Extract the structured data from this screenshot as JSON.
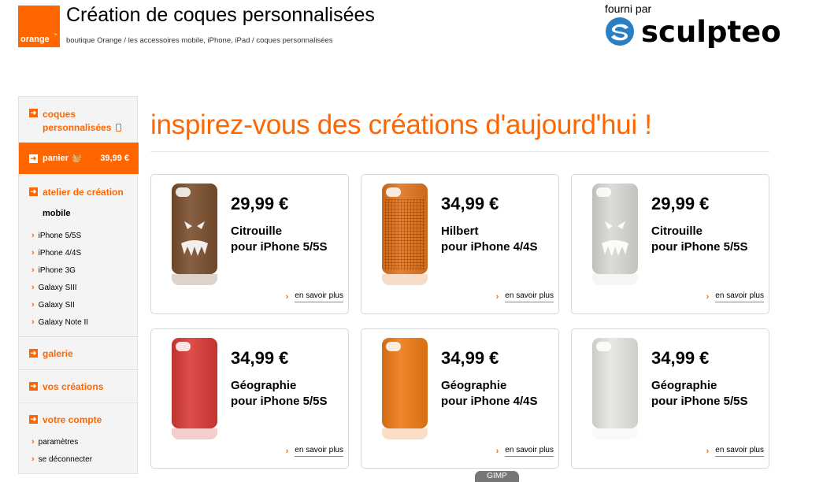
{
  "header": {
    "logo_text": "orange",
    "title": "Création de coques personnalisées",
    "breadcrumb": "boutique Orange / les accessoires mobile, iPhone, iPad / coques personnalisées",
    "provider_label": "fourni par",
    "provider_name": "sculpteo"
  },
  "sidebar": {
    "coques_line1": "coques",
    "coques_line2": "personnalisées",
    "panier_label": "panier",
    "panier_price": "39,99 €",
    "atelier_label": "atelier de création",
    "mobile_label": "mobile",
    "devices": [
      "iPhone 5/5S",
      "iPhone 4/4S",
      "iPhone 3G",
      "Galaxy SIII",
      "Galaxy SII",
      "Galaxy Note II"
    ],
    "galerie_label": "galerie",
    "creations_label": "vos créations",
    "compte_label": "votre compte",
    "account_links": [
      "paramètres",
      "se déconnecter"
    ]
  },
  "main": {
    "headline": "inspirez-vous des créations d'aujourd'hui !",
    "more_label": "en savoir plus",
    "products": [
      {
        "price": "29,99 €",
        "name": "Citrouille",
        "device": "pour iPhone 5/5S",
        "color": "#7a4e2d",
        "pattern": "face"
      },
      {
        "price": "34,99 €",
        "name": "Hilbert",
        "device": "pour iPhone 4/4S",
        "color": "#e0741f",
        "pattern": "grid"
      },
      {
        "price": "29,99 €",
        "name": "Citrouille",
        "device": "pour iPhone 5/5S",
        "color": "#d9d9d4",
        "pattern": "face"
      },
      {
        "price": "34,99 €",
        "name": "Géographie",
        "device": "pour iPhone 5/5S",
        "color": "#d93a35",
        "pattern": "plain"
      },
      {
        "price": "34,99 €",
        "name": "Géographie",
        "device": "pour iPhone 4/4S",
        "color": "#ee7a16",
        "pattern": "plain"
      },
      {
        "price": "34,99 €",
        "name": "Géographie",
        "device": "pour iPhone 5/5S",
        "color": "#e6e6e1",
        "pattern": "plain"
      }
    ]
  },
  "taskbar": {
    "label": "GIMP"
  },
  "colors": {
    "brand": "#ff6600"
  }
}
